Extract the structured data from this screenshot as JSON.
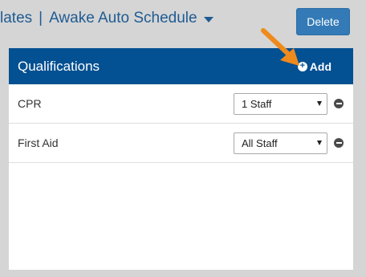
{
  "header": {
    "title_part1": "lates",
    "separator": "|",
    "title_part2": "Awake Auto Schedule"
  },
  "toolbar": {
    "delete_label": "Delete"
  },
  "panel": {
    "title": "Qualifications",
    "add_label": "Add",
    "rows": [
      {
        "label": "CPR",
        "selected": "1 Staff"
      },
      {
        "label": "First Aid",
        "selected": "All Staff"
      }
    ]
  },
  "colors": {
    "header_bg": "#035092",
    "delete_button": "#337ab7",
    "title_text": "#1f5b93",
    "annotation_arrow": "#ef8a1c"
  }
}
